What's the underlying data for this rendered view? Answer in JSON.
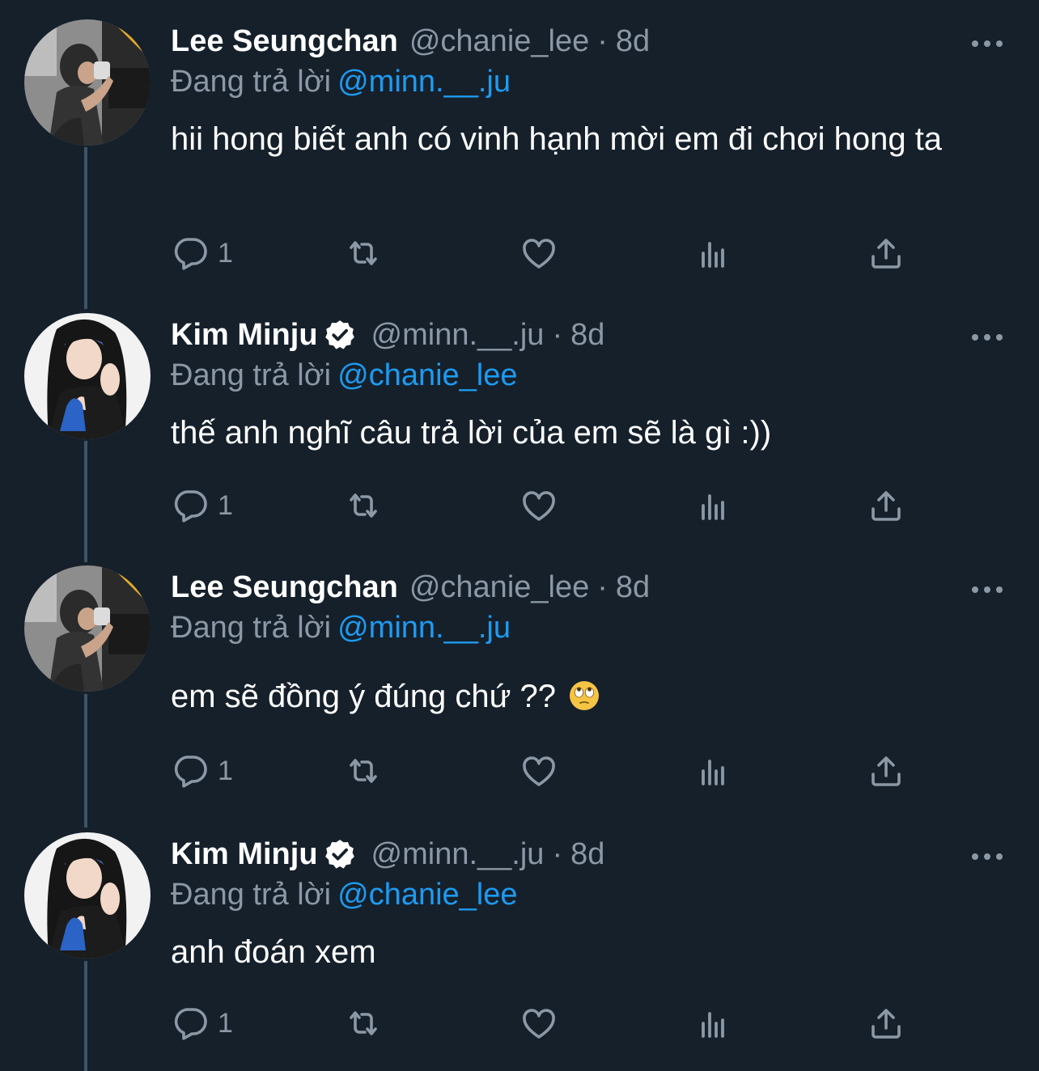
{
  "reply_prefix": "Đang trả lời",
  "tweets": [
    {
      "name": "Lee Seungchan",
      "verified": false,
      "handle": "@chanie_lee",
      "separator": "·",
      "time": "8d",
      "replying_to": "@minn.__.ju",
      "text": "hii hong biết anh có vinh hạnh mời em đi chơi hong ta",
      "reply_count": "1",
      "avatar": "avatar-lee-seungchan"
    },
    {
      "name": "Kim Minju",
      "verified": true,
      "handle": "@minn.__.ju",
      "separator": "·",
      "time": "8d",
      "replying_to": "@chanie_lee",
      "text": "thế anh nghĩ câu trả lời của em sẽ là gì :))",
      "reply_count": "1",
      "avatar": "avatar-kim-minju"
    },
    {
      "name": "Lee Seungchan",
      "verified": false,
      "handle": "@chanie_lee",
      "separator": "·",
      "time": "8d",
      "replying_to": "@minn.__.ju",
      "text": "em sẽ đồng ý đúng chứ ??",
      "emoji": "eye-roll-emoji",
      "reply_count": "1",
      "avatar": "avatar-lee-seungchan"
    },
    {
      "name": "Kim Minju",
      "verified": true,
      "handle": "@minn.__.ju",
      "separator": "·",
      "time": "8d",
      "replying_to": "@chanie_lee",
      "text": "anh đoán xem",
      "reply_count": "1",
      "avatar": "avatar-kim-minju"
    }
  ],
  "icons": {
    "reply": "reply-icon",
    "retweet": "retweet-icon",
    "like": "like-icon",
    "views": "views-icon",
    "share": "share-icon",
    "more": "more-icon",
    "verified": "verified-badge-icon"
  },
  "colors": {
    "background": "#15202b",
    "text": "#ffffff",
    "secondary": "#8b98a5",
    "link": "#1d9bf0",
    "thread_line": "#3d5466"
  }
}
